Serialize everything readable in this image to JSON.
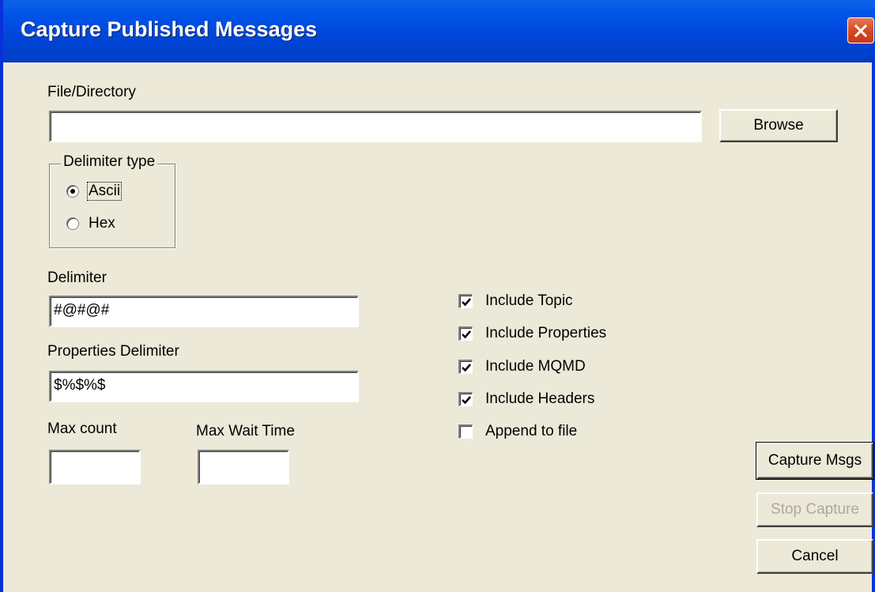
{
  "window": {
    "title": "Capture Published Messages"
  },
  "file": {
    "label": "File/Directory",
    "value": "",
    "browse_label": "Browse"
  },
  "delimiter_type": {
    "legend": "Delimiter type",
    "options": [
      {
        "label": "Ascii",
        "selected": true
      },
      {
        "label": "Hex",
        "selected": false
      }
    ]
  },
  "delimiter": {
    "label": "Delimiter",
    "value": "#@#@#"
  },
  "properties_delimiter": {
    "label": "Properties Delimiter",
    "value": "$%$%$"
  },
  "max_count": {
    "label": "Max count",
    "value": ""
  },
  "max_wait": {
    "label": "Max Wait Time",
    "value": ""
  },
  "options": [
    {
      "label": "Include Topic",
      "checked": true
    },
    {
      "label": "Include Properties",
      "checked": true
    },
    {
      "label": "Include MQMD",
      "checked": true
    },
    {
      "label": "Include Headers",
      "checked": true
    },
    {
      "label": "Append to file",
      "checked": false
    }
  ],
  "buttons": {
    "capture": "Capture Msgs",
    "stop": "Stop Capture",
    "cancel": "Cancel"
  },
  "icons": {
    "close": "close-icon"
  },
  "colors": {
    "titlebar": "#0055ea",
    "dialog_bg": "#ece9d8",
    "close_button": "#d64a23",
    "disabled_text": "#aca899"
  }
}
